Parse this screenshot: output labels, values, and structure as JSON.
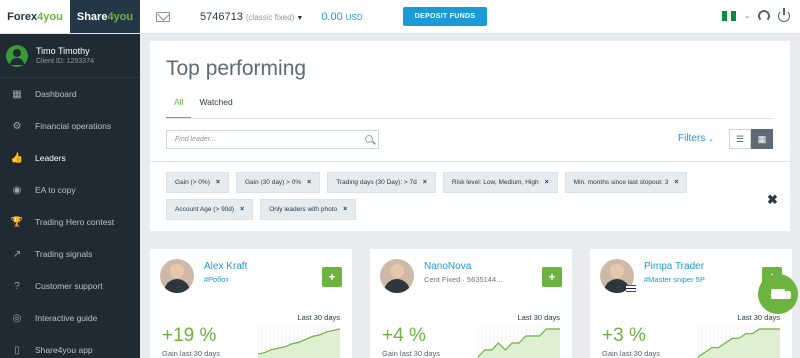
{
  "brand": {
    "forex_prefix": "Forex",
    "forex_suffix": "4you",
    "share_prefix": "Share",
    "share_suffix": "4you"
  },
  "user": {
    "name": "Timo Timothy",
    "client_id": "Client ID: 1293374"
  },
  "sidebar": {
    "items": [
      {
        "label": "Dashboard",
        "icon": "dashboard-icon",
        "glyph": "▦"
      },
      {
        "label": "Financial operations",
        "icon": "gear-icon",
        "glyph": "⚙"
      },
      {
        "label": "Leaders",
        "icon": "thumbs-up-icon",
        "glyph": "👍",
        "active": true
      },
      {
        "label": "EA to copy",
        "icon": "robot-icon",
        "glyph": "◉"
      },
      {
        "label": "Trading Hero contest",
        "icon": "trophy-icon",
        "glyph": "🏆"
      },
      {
        "label": "Trading signals",
        "icon": "chart-line-icon",
        "glyph": "↗"
      },
      {
        "label": "Customer support",
        "icon": "help-icon",
        "glyph": "?"
      },
      {
        "label": "Interactive guide",
        "icon": "compass-icon",
        "glyph": "◎"
      },
      {
        "label": "Share4you app",
        "icon": "mobile-icon",
        "glyph": "▯"
      }
    ]
  },
  "topbar": {
    "account_number": "5746713",
    "account_type": "(classic fixed)",
    "balance": "0.00",
    "currency": "USD",
    "deposit_label": "DEPOSIT FUNDS"
  },
  "page": {
    "title": "Top performing",
    "tabs": [
      {
        "label": "All",
        "active": true
      },
      {
        "label": "Watched"
      }
    ],
    "search_placeholder": "Find leader...",
    "filters_label": "Filters",
    "filter_chips": [
      "Gain (> 0%)",
      "Gain (30 day) > 0%",
      "Trading days (30 Day): > 7d",
      "Risk level: Low, Medium, High",
      "Min. months since last stopout: 3",
      "Account Age (> 90d)",
      "Only leaders with photo"
    ],
    "chip_remove": "×",
    "clear_all": "✖"
  },
  "leaders": [
    {
      "name": "Alex Kraft",
      "subtitle": "#Робот",
      "gain": "+19 %",
      "period": "Last 30 days",
      "gain_label": "Gain last 30 days",
      "spark": [
        2,
        3,
        5,
        6,
        7,
        9,
        10,
        12,
        14,
        15,
        17,
        18,
        19
      ]
    },
    {
      "name": "NanoNova",
      "subtitle": "Cent Fixed · 5635144...",
      "gain": "+4 %",
      "period": "Last 30 days",
      "gain_label": "Gain last 30 days",
      "spark": [
        0,
        1,
        1,
        2,
        1,
        2,
        2,
        3,
        3,
        3,
        4,
        4,
        4
      ]
    },
    {
      "name": "Pimpa Trader",
      "subtitle": "#Master sniper 5P",
      "gain": "+3 %",
      "period": "Last 30 days",
      "gain_label": "Gain last 30 days",
      "spark": [
        0,
        0.5,
        1,
        1,
        1.5,
        2,
        2,
        2.5,
        2.5,
        3,
        3,
        3,
        3
      ]
    }
  ],
  "colors": {
    "accent_green": "#6cb33f",
    "link_blue": "#1a9bd7",
    "sidebar_bg": "#1f2a33"
  }
}
